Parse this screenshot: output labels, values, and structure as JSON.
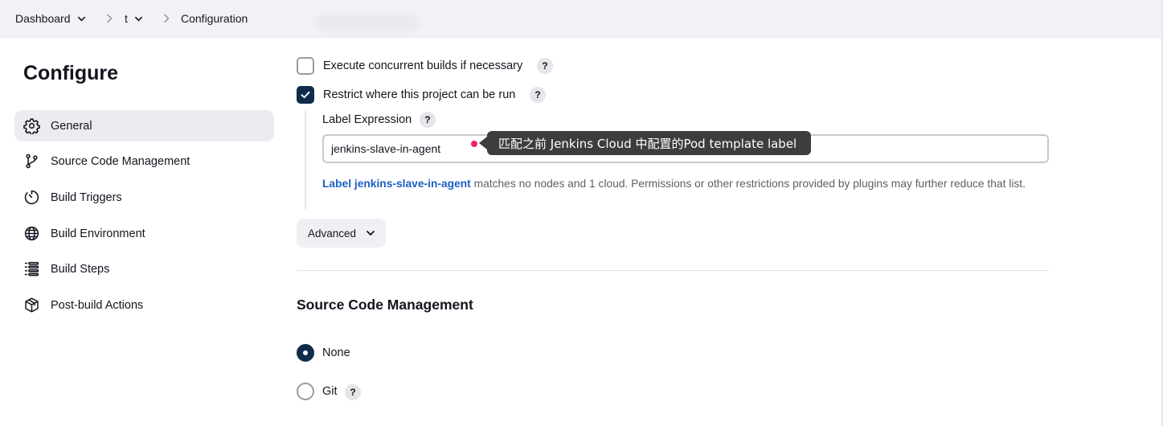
{
  "breadcrumb": {
    "items": [
      {
        "label": "Dashboard",
        "has_dropdown": true
      },
      {
        "label": "t",
        "has_dropdown": true
      },
      {
        "label": "Configuration",
        "has_dropdown": false
      }
    ]
  },
  "sidebar": {
    "title": "Configure",
    "items": [
      {
        "label": "General",
        "icon": "gear-icon",
        "active": true
      },
      {
        "label": "Source Code Management",
        "icon": "git-branch-icon",
        "active": false
      },
      {
        "label": "Build Triggers",
        "icon": "timer-icon",
        "active": false
      },
      {
        "label": "Build Environment",
        "icon": "globe-icon",
        "active": false
      },
      {
        "label": "Build Steps",
        "icon": "list-steps-icon",
        "active": false
      },
      {
        "label": "Post-build Actions",
        "icon": "package-icon",
        "active": false
      }
    ]
  },
  "general": {
    "concurrent": {
      "label": "Execute concurrent builds if necessary",
      "checked": false
    },
    "restrict": {
      "label": "Restrict where this project can be run",
      "checked": true
    },
    "label_expression": {
      "label": "Label Expression",
      "value": "jenkins-slave-in-agent"
    },
    "tooltip": "匹配之前 Jenkins Cloud 中配置的Pod template label",
    "info": {
      "link_text": "Label jenkins-slave-in-agent",
      "text": " matches no nodes and 1 cloud. Permissions or other restrictions provided by plugins may further reduce that list."
    },
    "advanced_label": "Advanced",
    "help_symbol": "?"
  },
  "scm": {
    "title": "Source Code Management",
    "options": [
      {
        "label": "None",
        "selected": true
      },
      {
        "label": "Git",
        "selected": false
      }
    ]
  },
  "colors": {
    "accent": "#0f2d4a",
    "link": "#1d5fc4",
    "tooltip_bg": "#3d3d3d",
    "marker": "#f0245e"
  }
}
